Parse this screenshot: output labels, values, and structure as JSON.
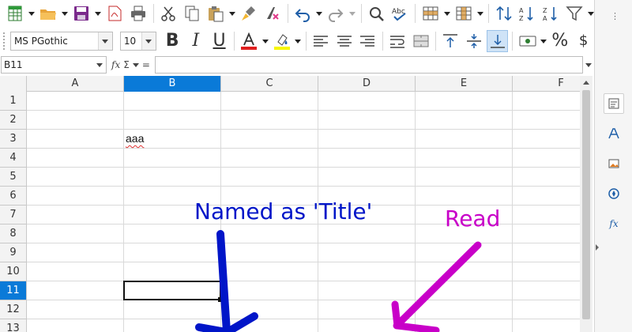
{
  "toolbar_standard": {
    "icons": [
      "new-spreadsheet-icon",
      "open-folder-icon",
      "save-icon",
      "export-pdf-icon",
      "print-icon",
      "cut-icon",
      "copy-icon",
      "paste-icon",
      "clone-formatting-icon",
      "clear-formatting-icon",
      "undo-icon",
      "redo-icon",
      "find-replace-icon",
      "spelling-icon",
      "row-icon",
      "column-icon",
      "sort-icon",
      "sort-ascending-icon",
      "sort-descending-icon",
      "autofilter-icon"
    ]
  },
  "toolbar_formatting": {
    "font_name": "MS PGothic",
    "font_size": "10",
    "bold_label": "B",
    "italic_label": "I",
    "underline_label": "U",
    "font_color": "#e02020",
    "highlight_color": "#f7f700",
    "percent_label": "%",
    "currency_label": "$"
  },
  "formula_bar": {
    "name_box": "B11",
    "fx_label": "fx",
    "sum_label": "Σ",
    "equals_label": "=",
    "formula": ""
  },
  "sheet": {
    "columns": [
      "A",
      "B",
      "C",
      "D",
      "E",
      "F"
    ],
    "selected_column": "B",
    "rows": [
      "1",
      "2",
      "3",
      "4",
      "5",
      "6",
      "7",
      "8",
      "9",
      "10",
      "11",
      "12",
      "13"
    ],
    "selected_row": "11",
    "cells": {
      "B3": "aaa"
    },
    "active_cell": "B11"
  },
  "sidebar": {
    "buttons": [
      "properties-icon",
      "styles-icon",
      "gallery-icon",
      "navigator-icon",
      "functions-icon"
    ],
    "functions_label": "fx"
  },
  "annotations": {
    "title_note": "Named as 'Title'",
    "title_color": "#0015c8",
    "read_note": "Read",
    "read_color": "#c800c8"
  }
}
